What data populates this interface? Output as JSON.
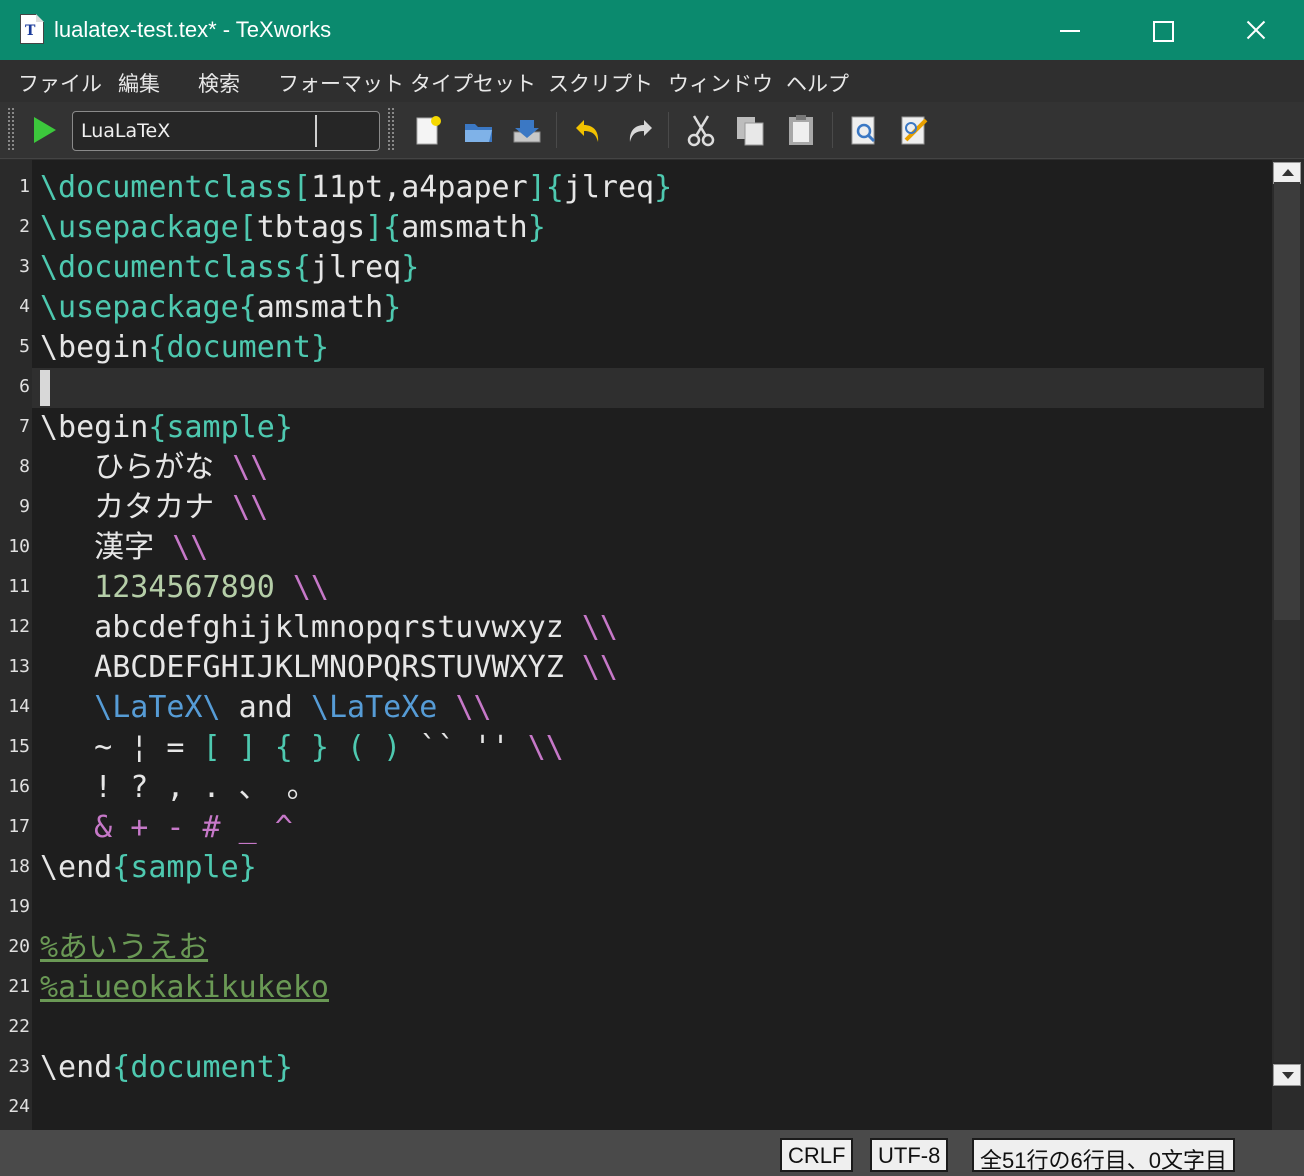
{
  "window": {
    "title": "lualatex-test.tex* - TeXworks"
  },
  "menu": {
    "items": [
      "ファイル",
      "編集",
      "検索",
      "フォーマット",
      "タイプセット",
      "スクリプト",
      "ウィンドウ",
      "ヘルプ"
    ]
  },
  "toolbar": {
    "engine": "LuaLaTeX",
    "icons": [
      "typeset-play-icon",
      "new-document-icon",
      "open-folder-icon",
      "save-icon",
      "undo-icon",
      "redo-icon",
      "cut-icon",
      "copy-icon",
      "paste-icon",
      "find-icon",
      "replace-icon"
    ]
  },
  "editor": {
    "current_line": 6,
    "line_numbers": [
      "1",
      "2",
      "3",
      "4",
      "5",
      "6",
      "7",
      "8",
      "9",
      "10",
      "11",
      "12",
      "13",
      "14",
      "15",
      "16",
      "17",
      "18",
      "19",
      "20",
      "21",
      "22",
      "23",
      "24"
    ],
    "lines": [
      [
        {
          "t": "\\documentclass",
          "c": "cmd"
        },
        {
          "t": "[",
          "c": "brk"
        },
        {
          "t": "11pt,a4paper",
          "c": "txt"
        },
        {
          "t": "]{",
          "c": "brk"
        },
        {
          "t": "jlreq",
          "c": "txt"
        },
        {
          "t": "}",
          "c": "brk"
        }
      ],
      [
        {
          "t": "\\usepackage",
          "c": "cmd"
        },
        {
          "t": "[",
          "c": "brk"
        },
        {
          "t": "tbtags",
          "c": "txt"
        },
        {
          "t": "]{",
          "c": "brk"
        },
        {
          "t": "amsmath",
          "c": "txt"
        },
        {
          "t": "}",
          "c": "brk"
        }
      ],
      [
        {
          "t": "\\documentclass",
          "c": "cmd"
        },
        {
          "t": "{",
          "c": "brk"
        },
        {
          "t": "jlreq",
          "c": "txt"
        },
        {
          "t": "}",
          "c": "brk"
        }
      ],
      [
        {
          "t": "\\usepackage",
          "c": "cmd"
        },
        {
          "t": "{",
          "c": "brk"
        },
        {
          "t": "amsmath",
          "c": "txt"
        },
        {
          "t": "}",
          "c": "brk"
        }
      ],
      [
        {
          "t": "\\begin",
          "c": "txt"
        },
        {
          "t": "{",
          "c": "brk"
        },
        {
          "t": "document",
          "c": "cmd"
        },
        {
          "t": "}",
          "c": "brk"
        }
      ],
      [],
      [
        {
          "t": "\\begin",
          "c": "txt"
        },
        {
          "t": "{",
          "c": "brk"
        },
        {
          "t": "sample",
          "c": "cmd"
        },
        {
          "t": "}",
          "c": "brk"
        }
      ],
      [
        {
          "t": "   ひらがな ",
          "c": "txt"
        },
        {
          "t": "\\\\",
          "c": "spc"
        }
      ],
      [
        {
          "t": "   カタカナ ",
          "c": "txt"
        },
        {
          "t": "\\\\",
          "c": "spc"
        }
      ],
      [
        {
          "t": "   漢字 ",
          "c": "txt"
        },
        {
          "t": "\\\\",
          "c": "spc"
        }
      ],
      [
        {
          "t": "   1234567890 ",
          "c": "num"
        },
        {
          "t": "\\\\",
          "c": "spc"
        }
      ],
      [
        {
          "t": "   abcdefghijklmnopqrstuvwxyz ",
          "c": "txt"
        },
        {
          "t": "\\\\",
          "c": "spc"
        }
      ],
      [
        {
          "t": "   ABCDEFGHIJKLMNOPQRSTUVWXYZ ",
          "c": "txt"
        },
        {
          "t": "\\\\",
          "c": "spc"
        }
      ],
      [
        {
          "t": "   ",
          "c": "txt"
        },
        {
          "t": "\\LaTeX\\",
          "c": "blu"
        },
        {
          "t": " and ",
          "c": "txt"
        },
        {
          "t": "\\LaTeXe",
          "c": "blu"
        },
        {
          "t": " ",
          "c": "txt"
        },
        {
          "t": "\\\\",
          "c": "spc"
        }
      ],
      [
        {
          "t": "   ~ ¦ = ",
          "c": "txt"
        },
        {
          "t": "[ ] { } ( )",
          "c": "brk"
        },
        {
          "t": " `` '' ",
          "c": "txt"
        },
        {
          "t": "\\\\",
          "c": "spc"
        }
      ],
      [
        {
          "t": "   ! ? , . 、 。",
          "c": "txt"
        }
      ],
      [
        {
          "t": "   & + - # _ ^",
          "c": "spc"
        }
      ],
      [
        {
          "t": "\\end",
          "c": "txt"
        },
        {
          "t": "{",
          "c": "brk"
        },
        {
          "t": "sample",
          "c": "cmd"
        },
        {
          "t": "}",
          "c": "brk"
        }
      ],
      [],
      [
        {
          "t": "%あいうえお",
          "c": "cmt"
        }
      ],
      [
        {
          "t": "%aiueokakikukeko",
          "c": "cmt"
        }
      ],
      [],
      [
        {
          "t": "\\end",
          "c": "txt"
        },
        {
          "t": "{",
          "c": "brk"
        },
        {
          "t": "document",
          "c": "cmd"
        },
        {
          "t": "}",
          "c": "brk"
        }
      ],
      []
    ]
  },
  "status": {
    "line_ending": "CRLF",
    "encoding": "UTF-8",
    "position": "全51行の6行目、0文字目"
  },
  "colors": {
    "titlebar": "#0b8a6e",
    "command": "#4ec9b0",
    "special": "#c678c8",
    "latex_logo": "#569cd6",
    "number": "#b5cea8",
    "comment": "#6a9955"
  }
}
